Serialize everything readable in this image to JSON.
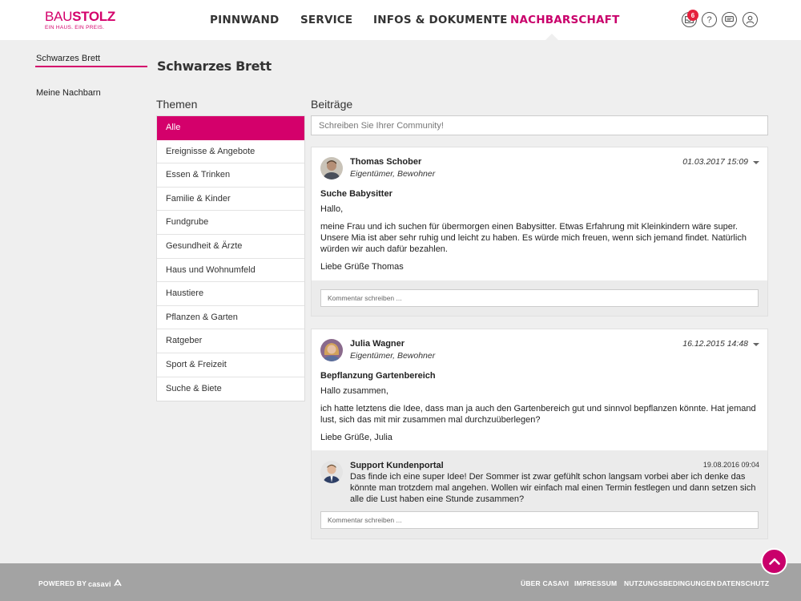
{
  "brand": {
    "name_light": "BAU",
    "name_bold": "STOLZ",
    "tagline": "EIN HAUS. EIN PREIS.",
    "color": "#d4006b"
  },
  "nav": [
    {
      "label": "PINNWAND"
    },
    {
      "label": "SERVICE"
    },
    {
      "label": "INFOS & DOKUMENTE"
    },
    {
      "label": "NACHBARSCHAFT",
      "active": true
    }
  ],
  "header_icons": {
    "notifications_count": "6",
    "help": "?",
    "messages": "chat",
    "profile": "user"
  },
  "left_nav": {
    "items": [
      {
        "label": "Schwarzes Brett",
        "active": true
      },
      {
        "label": "Meine Nachbarn"
      }
    ]
  },
  "page_title": "Schwarzes Brett",
  "themes": {
    "title": "Themen",
    "items": [
      "Alle",
      "Ereignisse & Angebote",
      "Essen & Trinken",
      "Familie & Kinder",
      "Fundgrube",
      "Gesundheit & Ärzte",
      "Haus und Wohnumfeld",
      "Haustiere",
      "Pflanzen & Garten",
      "Ratgeber",
      "Sport & Freizeit",
      "Suche & Biete"
    ],
    "active_index": 0
  },
  "posts_section": {
    "title": "Beiträge",
    "compose_placeholder": "Schreiben Sie Ihrer Community!",
    "comment_placeholder": "Kommentar schreiben ..."
  },
  "posts": [
    {
      "author": "Thomas Schober",
      "role": "Eigentümer, Bewohner",
      "date": "01.03.2017 15:09",
      "title": "Suche Babysitter",
      "greeting": "Hallo,",
      "body": "meine Frau und ich suchen für übermorgen einen Babysitter. Etwas Erfahrung mit Kleinkindern wäre super. Unsere Mia ist aber sehr ruhig und leicht zu haben. Es würde mich freuen, wenn sich jemand findet. Natürlich würden wir auch dafür bezahlen.",
      "closing": "Liebe Grüße Thomas"
    },
    {
      "author": "Julia Wagner",
      "role": "Eigentümer, Bewohner",
      "date": "16.12.2015 14:48",
      "title": "Bepflanzung Gartenbereich",
      "greeting": "Hallo zusammen,",
      "body": "ich hatte letztens die Idee, dass man ja auch den Gartenbereich gut und sinnvol bepflanzen könnte. Hat jemand lust, sich das mit mir zusammen mal durchzuüberlegen?",
      "closing": "Liebe Grüße, Julia",
      "comments": [
        {
          "author": "Support Kundenportal",
          "date": "19.08.2016 09:04",
          "text": "Das finde ich eine super Idee! Der Sommer ist zwar gefühlt schon langsam vorbei aber ich denke das könnte man trotzdem mal angehen. Wollen wir einfach mal einen Termin festlegen und dann setzen sich alle die Lust haben eine Stunde zusammen?"
        }
      ]
    }
  ],
  "footer": {
    "powered_by": "POWERED BY",
    "powered_logo": "casavi",
    "links": [
      "ÜBER CASAVI",
      "IMPRESSUM",
      "NUTZUNGSBEDINGUNGEN",
      "DATENSCHUTZ"
    ]
  }
}
